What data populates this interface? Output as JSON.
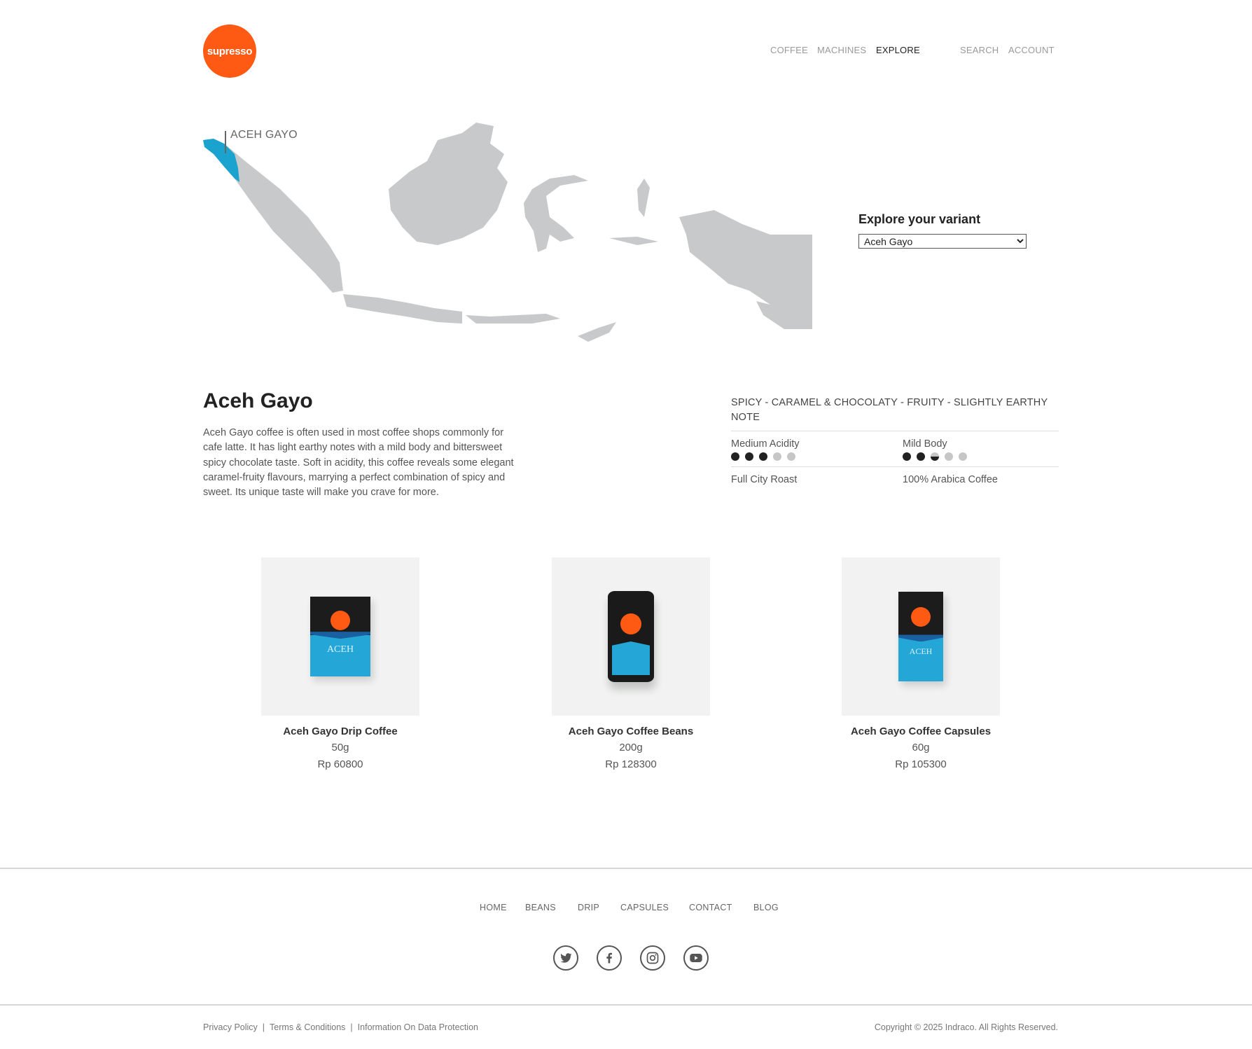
{
  "header": {
    "logo_text": "supresso",
    "nav": {
      "coffee": "COFFEE",
      "machines": "MACHINES",
      "explore": "EXPLORE",
      "search": "SEARCH",
      "account": "ACCOUNT"
    }
  },
  "map": {
    "region_label": "ACEH GAYO",
    "highlight_color": "#1ba3cf",
    "base_color": "#c8c9ca"
  },
  "explore": {
    "title": "Explore your variant",
    "selected_variant": "Aceh Gayo"
  },
  "product": {
    "title": "Aceh Gayo",
    "description": "Aceh Gayo coffee is often used in most coffee shops commonly for cafe latte. It has light earthy notes with a mild body and bittersweet spicy chocolate taste. Soft in acidity, this coffee reveals some elegant caramel-fruity flavours, marrying a perfect combination of spicy and sweet. Its unique taste will make you crave for more.",
    "tasting_notes": "SPICY - CARAMEL & CHOCOLATY - FRUITY - SLIGHTLY EARTHY NOTE",
    "acidity_label": "Medium Acidity",
    "acidity_level": 3,
    "body_label": "Mild Body",
    "body_level": 2.5,
    "scale_max": 5,
    "roast": "Full City Roast",
    "origin": "100% Arabica Coffee"
  },
  "products": [
    {
      "name": "Aceh Gayo Drip Coffee",
      "size": "50g",
      "price": "Rp 60800",
      "pkg_text": "ACEH"
    },
    {
      "name": "Aceh Gayo Coffee Beans",
      "size": "200g",
      "price": "Rp 128300"
    },
    {
      "name": "Aceh Gayo Coffee Capsules",
      "size": "60g",
      "price": "Rp 105300",
      "pkg_text": "ACEH"
    }
  ],
  "footer": {
    "nav": {
      "home": "HOME",
      "beans": "BEANS",
      "drip": "DRIP",
      "capsules": "CAPSULES",
      "contact": "CONTACT",
      "blog": "BLOG"
    },
    "social": [
      "twitter-icon",
      "facebook-icon",
      "instagram-icon",
      "youtube-icon"
    ],
    "privacy": "Privacy Policy",
    "terms": "Terms & Conditions",
    "data_protection": "Information On Data Protection",
    "separator": "|",
    "copyright": "Copyright © 2025 Indraco. All Rights Reserved."
  },
  "colors": {
    "brand_orange": "#ff5a14",
    "accent_blue": "#24a7d6"
  }
}
